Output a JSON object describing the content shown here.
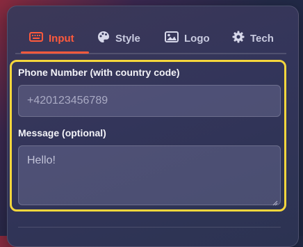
{
  "tabs": [
    {
      "label": "Input",
      "icon": "keyboard-icon",
      "active": true
    },
    {
      "label": "Style",
      "icon": "palette-icon",
      "active": false
    },
    {
      "label": "Logo",
      "icon": "image-icon",
      "active": false
    },
    {
      "label": "Tech",
      "icon": "gear-icon",
      "active": false
    }
  ],
  "form": {
    "phone_label": "Phone Number (with country code)",
    "phone_placeholder": "+420123456789",
    "message_label": "Message (optional)",
    "message_placeholder": "Hello!"
  },
  "colors": {
    "accent": "#ff5a3c",
    "highlight": "#f5d63c"
  }
}
